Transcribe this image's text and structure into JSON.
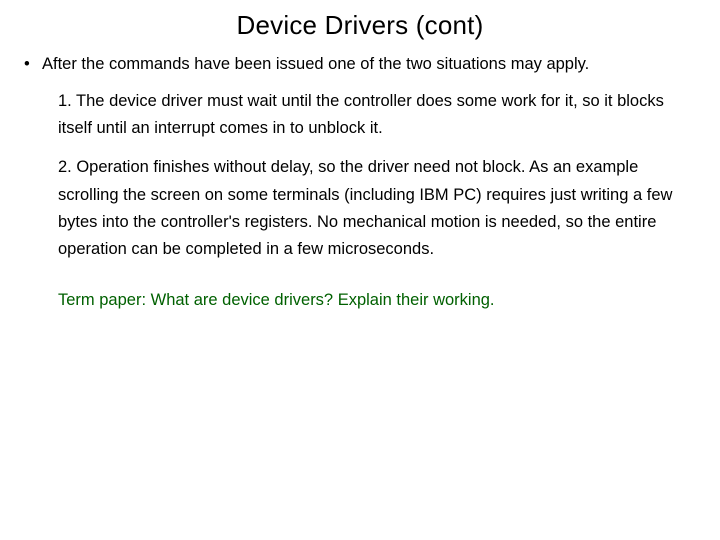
{
  "title": "Device Drivers (cont)",
  "bullet": {
    "marker": "•",
    "text": "After the commands have been issued one of the two situations may apply."
  },
  "items": [
    "1. The device driver must wait until the controller does some work for it, so it blocks itself until an interrupt comes in to unblock it.",
    "2. Operation finishes without delay, so the driver need not block. As an example scrolling the screen on some terminals (including IBM PC) requires just writing a few bytes into the controller's registers. No mechanical motion is needed, so the entire operation can be completed in a few microseconds."
  ],
  "term_paper": "Term paper: What are device drivers? Explain their working."
}
